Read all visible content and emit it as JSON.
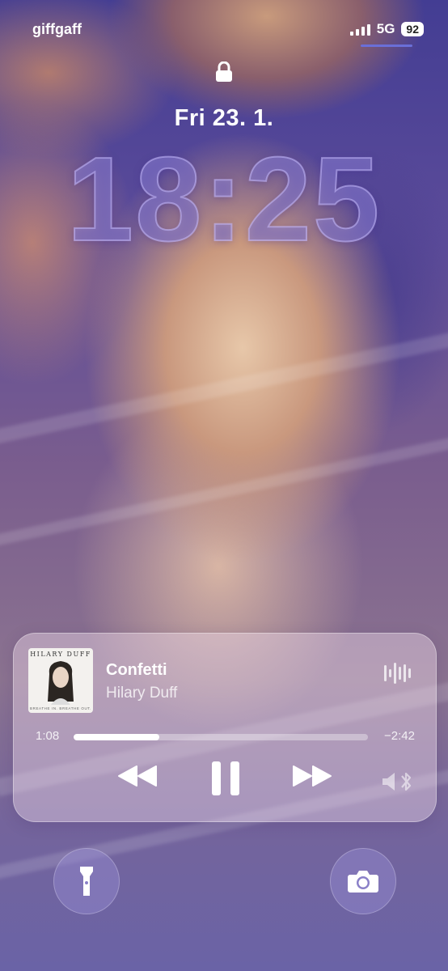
{
  "status_bar": {
    "carrier": "giffgaff",
    "network": "5G",
    "battery": "92"
  },
  "lock_screen": {
    "date": "Fri 23. 1.",
    "time": "18:25"
  },
  "now_playing": {
    "album_art_text": {
      "artist": "HILARY DUFF",
      "subtitle": "BREATHE IN. BREATHE OUT."
    },
    "track_title": "Confetti",
    "artist": "Hilary Duff",
    "elapsed": "1:08",
    "remaining": "−2:42",
    "progress": 0.29
  },
  "icons": {
    "lock": "lock-icon",
    "waveform": "waveform-icon",
    "rewind": "rewind-icon",
    "pause": "pause-icon",
    "forward": "fast-forward-icon",
    "airplay": "audio-output-icon",
    "flashlight": "flashlight-icon",
    "camera": "camera-icon"
  }
}
